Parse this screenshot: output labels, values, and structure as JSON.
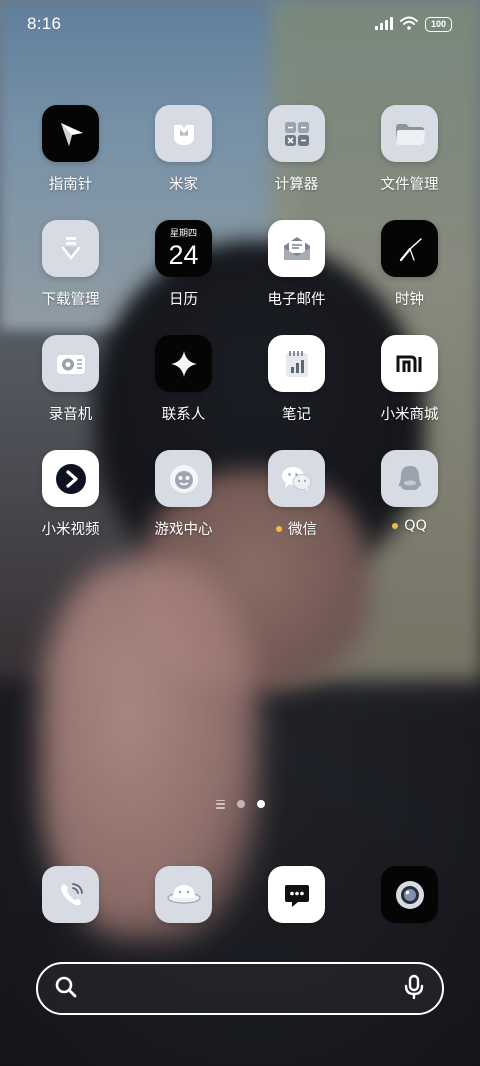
{
  "status_bar": {
    "time": "8:16",
    "battery": "100"
  },
  "apps": [
    {
      "label": "指南针",
      "icon": "compass-icon"
    },
    {
      "label": "米家",
      "icon": "mi-home-icon"
    },
    {
      "label": "计算器",
      "icon": "calculator-icon"
    },
    {
      "label": "文件管理",
      "icon": "folder-icon"
    },
    {
      "label": "下载管理",
      "icon": "download-icon"
    },
    {
      "label": "日历",
      "icon": "calendar-icon",
      "weekday": "星期四",
      "day": "24"
    },
    {
      "label": "电子邮件",
      "icon": "mail-icon"
    },
    {
      "label": "时钟",
      "icon": "clock-icon"
    },
    {
      "label": "录音机",
      "icon": "recorder-icon"
    },
    {
      "label": "联系人",
      "icon": "contacts-icon"
    },
    {
      "label": "笔记",
      "icon": "notes-icon"
    },
    {
      "label": "小米商城",
      "icon": "mi-store-icon"
    },
    {
      "label": "小米视频",
      "icon": "video-play-icon"
    },
    {
      "label": "游戏中心",
      "icon": "game-center-icon"
    },
    {
      "label": "微信",
      "icon": "wechat-icon",
      "badge": true
    },
    {
      "label": "QQ",
      "icon": "qq-icon",
      "badge": true
    }
  ],
  "dock": [
    {
      "icon": "phone-icon"
    },
    {
      "icon": "browser-icon"
    },
    {
      "icon": "messages-icon"
    },
    {
      "icon": "camera-icon"
    }
  ],
  "colors": {
    "badge": "#f1b948",
    "icon_light": "#d7dbe3",
    "icon_dark": "#050505"
  }
}
